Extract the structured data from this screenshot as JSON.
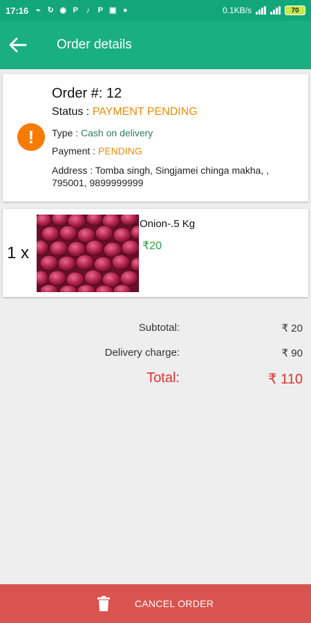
{
  "status_bar": {
    "time": "17:16",
    "network_speed": "0.1KB/s",
    "battery": "70"
  },
  "app_bar": {
    "title": "Order details"
  },
  "order": {
    "number_label": "Order #: 12",
    "status_label": "Status : ",
    "status_value": "PAYMENT PENDING",
    "type_label": "Type : ",
    "type_value": "Cash on delivery",
    "payment_label": "Payment : ",
    "payment_value": "PENDING",
    "address": "Address : Tomba singh, Singjamei chinga makha, , 795001, 9899999999",
    "alert_icon": "!"
  },
  "items": [
    {
      "quantity": "1 x",
      "name": "Onion-.5 Kg",
      "price": "₹20",
      "image": "onion-photo"
    }
  ],
  "summary": {
    "subtotal_label": "Subtotal:",
    "subtotal_value": "₹ 20",
    "delivery_label": "Delivery charge:",
    "delivery_value": "₹ 90",
    "total_label": "Total:",
    "total_value": "₹ 110"
  },
  "actions": {
    "cancel_label": "CANCEL ORDER"
  },
  "colors": {
    "primary": "#1aaf80",
    "status_orange": "#ef8a00",
    "price_green": "#2e9a3e",
    "total_red": "#e03232",
    "cancel_red": "#d9534f"
  }
}
